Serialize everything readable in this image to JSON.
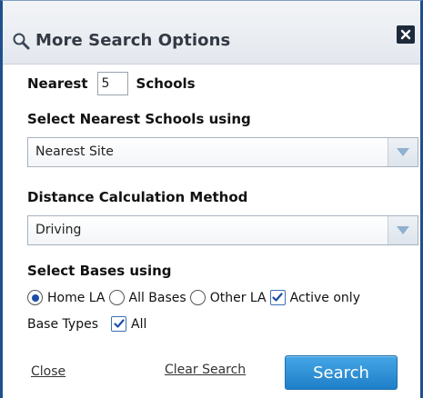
{
  "dialog": {
    "title": "More Search Options",
    "title_icon": "magnifier-icon",
    "close_icon": "close-x-icon"
  },
  "nearest": {
    "prefix": "Nearest",
    "value": "5",
    "suffix": "Schools"
  },
  "select_nearest": {
    "label": "Select Nearest Schools using",
    "selected": "Nearest Site"
  },
  "distance_method": {
    "label": "Distance Calculation Method",
    "selected": "Driving"
  },
  "bases": {
    "label": "Select Bases using",
    "options": [
      {
        "label": "Home LA",
        "selected": true
      },
      {
        "label": "All Bases",
        "selected": false
      },
      {
        "label": "Other LA",
        "selected": false
      }
    ],
    "active_only": {
      "label": "Active only",
      "checked": true
    }
  },
  "base_types": {
    "label": "Base Types",
    "all": {
      "label": "All",
      "checked": true
    }
  },
  "footer": {
    "close_label": "Close",
    "clear_label": "Clear Search",
    "search_label": "Search"
  },
  "colors": {
    "border": "#1f4f8c",
    "button": "#2a8ad6",
    "radio_dot": "#1b4fa8"
  }
}
